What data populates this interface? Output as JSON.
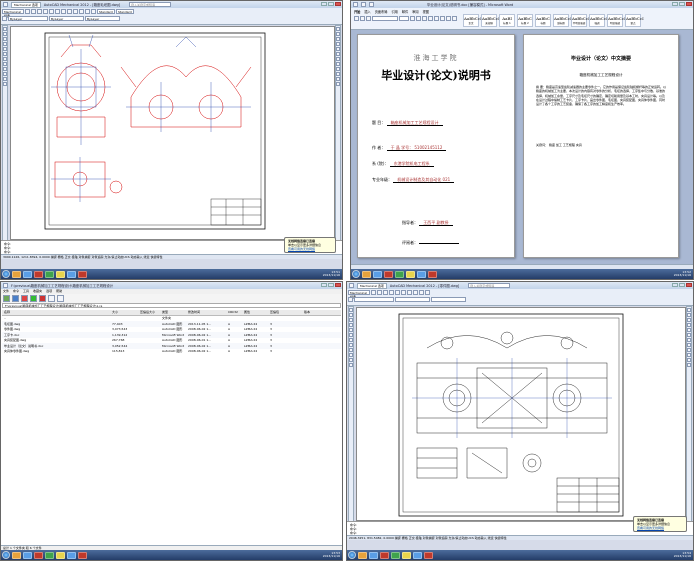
{
  "cad1": {
    "title": "AutoCAD Mechanical 2012 - [箱座毛坯图.dwg]",
    "tab": "Mechanical 选项",
    "search_placeholder": "键入关键字或短语",
    "workspace": "Mechanical 经典",
    "style1": "Standard",
    "style2": "Standard",
    "layer": "ByLayer",
    "line1": "ByLayer",
    "line2": "ByLayer",
    "cmd1": "命令:",
    "cmd2": "命令:",
    "cmd3": "命令:",
    "status": "3990.1126, 1211.8394, 0.0000  捕捉 栅格 正交 极轴 对象捕捉 对象追踪 允许/禁止动态UCS 动态输入 线宽 快捷特性",
    "balloon_title": "无线网络连接已连接",
    "balloon_body": "单击以显示更多详细信息",
    "balloon_link": "查看可用的无线网络",
    "clock_time": "13:51",
    "clock_date": "2013/11/16"
  },
  "word": {
    "title": "毕业设计(论文)说明书.doc [兼容模式] - Microsoft Word",
    "ribbon_tabs": [
      "开始",
      "插入",
      "页面布局",
      "引用",
      "邮件",
      "审阅",
      "视图"
    ],
    "style_samples": [
      {
        "sample": "AaBbCcI",
        "name": "正文"
      },
      {
        "sample": "AaBbCcI",
        "name": "无间隔"
      },
      {
        "sample": "AaBl",
        "name": "标题 1"
      },
      {
        "sample": "AaBbC",
        "name": "标题 2"
      },
      {
        "sample": "AaBbC",
        "name": "标题"
      },
      {
        "sample": "AaBbCcI",
        "name": "副标题"
      },
      {
        "sample": "AaBbCcI",
        "name": "不明显强调"
      },
      {
        "sample": "AaBbCcI",
        "name": "强调"
      },
      {
        "sample": "AaBbCcI",
        "name": "明显强调"
      },
      {
        "sample": "AaBbCcI",
        "name": "要点"
      }
    ],
    "school": "淮海工学院",
    "doc_title": "毕业设计(论文)说明书",
    "field_topic_label": "题    目：",
    "field_topic_value": "箱座机械加工工艺规程设计",
    "field_author_label": "作    者：",
    "field_author_value": "于   晶     学号：  51002145112",
    "field_dept_label": "系  (院)：",
    "field_dept_value": "东港学院机电工程系",
    "field_major_label": "专业年级：",
    "field_major_value": "机械设计制造及其自动化 021",
    "field_tutor_label": "指导者：",
    "field_tutor_value": "王西平        副教授",
    "field_review_label": "评阅者：",
    "abstract_header": "毕业设计（论文）中文摘要",
    "abstract_sub": "箱座机械加工工艺规程设计",
    "abstract_body": "摘  要：箱座是高速型齿轮减速器的主要零件之一。它的作用是保证齿轮轴和蜗杆等的正常运转。以箱座的机械加工为主要，本次设计的内容有对零件的分析，毛坯的选择，工序集中与分散，基准的选择，机械加工余量，工序尺寸及毛坯尺寸的确定，确定切削用量及基本工时，夹具设计等。以及在设计过程中编制工艺卡片、工序卡片，画出零件图，毛坯图，夹具装配图，夹具体零件图，同时设计了各个工序的工艺装备，确保了各工序的加工精度和生产效率。",
    "keywords": "关键词：  箱座  加工  工艺规程  夹具",
    "clock_time": "13:52",
    "clock_date": "2013/11/16"
  },
  "explorer": {
    "title": "F:\\previous\\箱座机械加工工艺规程设计\\箱座机械加工工艺规程设计",
    "path": "F:\\previous\\箱座机械加工工艺规程设计\\箱座机械加工工艺规程设计\\1.ra",
    "menu": [
      "文件",
      "命令",
      "工具",
      "收藏夹",
      "选项",
      "帮助"
    ],
    "columns": [
      "名称",
      "大小",
      "压缩后大小",
      "类型",
      "修改时间",
      "CRC32",
      "属性",
      "压缩包",
      "版本"
    ],
    "rows": [
      {
        "name": "..",
        "size": "",
        "packed": "",
        "type": "文件夹",
        "date": "",
        "crc": "",
        "attr": "",
        "ver": ""
      },
      {
        "name": "毛坯图.dwg",
        "size": "77,403",
        "packed": "",
        "type": "AutoCAD 图形",
        "date": "2013-11-05 1...",
        "crc": "A",
        "attr": "LZMA:24",
        "ver": "3"
      },
      {
        "name": "零件图.dwg",
        "size": "3,073,543",
        "packed": "",
        "type": "AutoCAD 图形",
        "date": "2008-06-02 1...",
        "crc": "A",
        "attr": "LZMA:24",
        "ver": "3"
      },
      {
        "name": "工序卡.doc",
        "size": "1,139,312",
        "packed": "",
        "type": "Microsoft Word",
        "date": "2008-06-02 1...",
        "crc": "A",
        "attr": "LZMA:24",
        "ver": "3"
      },
      {
        "name": "夹具装配图.dwg",
        "size": "267,768",
        "packed": "",
        "type": "AutoCAD 图形",
        "date": "2008-06-01 1...",
        "crc": "A",
        "attr": "LZMA:24",
        "ver": "3"
      },
      {
        "name": "毕业设计（论文）说明书.doc",
        "size": "3,052,544",
        "packed": "",
        "type": "Microsoft Word",
        "date": "2008-06-02 1...",
        "crc": "A",
        "attr": "LZMA:24",
        "ver": "3"
      },
      {
        "name": "夹具体零件图.dwg",
        "size": "115,813",
        "packed": "",
        "type": "AutoCAD 图形",
        "date": "2008-06-02 1...",
        "crc": "A",
        "attr": "LZMA:24",
        "ver": "3"
      }
    ],
    "status": "总计 1 个文件夹 和 6 个文件",
    "clock_time": "13:53",
    "clock_date": "2013/11/16"
  },
  "cad2": {
    "title": "AutoCAD Mechanical 2012 - [零件图.dwg]",
    "tab": "Mechanical 选项",
    "search_placeholder": "键入关键字或短语",
    "workspace": "Mechanical 经典",
    "cmd1": "命令:",
    "cmd2": "命令:",
    "cmd3": "命令:",
    "status": "2046.3251, 831.5482, 0.0000  捕捉 栅格 正交 极轴 对象捕捉 对象追踪 允许/禁止动态UCS 动态输入 线宽 快捷特性",
    "balloon_title": "无线网络连接已连接",
    "balloon_body": "单击以显示更多详细信息",
    "balloon_link": "查看可用的无线网络",
    "clock_time": "13:54",
    "clock_date": "2013/11/16"
  },
  "colors": {
    "drawing_red": "#d40000",
    "drawing_blue": "#1f3fa8",
    "drawing_black": "#111111",
    "taskbar": "#243d68"
  }
}
